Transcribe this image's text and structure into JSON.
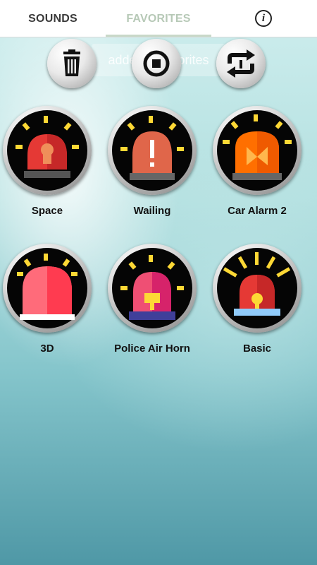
{
  "tabs": {
    "sounds": "SOUNDS",
    "favorites": "FAVORITES",
    "info_icon": "i"
  },
  "hint_text": "added to favorites",
  "controls": {
    "trash": "trash-icon",
    "stop": "stop-icon",
    "repeat": "repeat-icon"
  },
  "sounds": [
    {
      "label": "Space"
    },
    {
      "label": "Wailing"
    },
    {
      "label": "Car Alarm 2"
    },
    {
      "label": "3D"
    },
    {
      "label": "Police Air Horn"
    },
    {
      "label": "Basic"
    }
  ],
  "colors": {
    "active_tab": "#3a3a3a",
    "inactive_tab": "#b7c9b7",
    "siren_red": "#e53935",
    "siren_orange": "#ff6f00",
    "siren_yellow": "#fdd835"
  }
}
